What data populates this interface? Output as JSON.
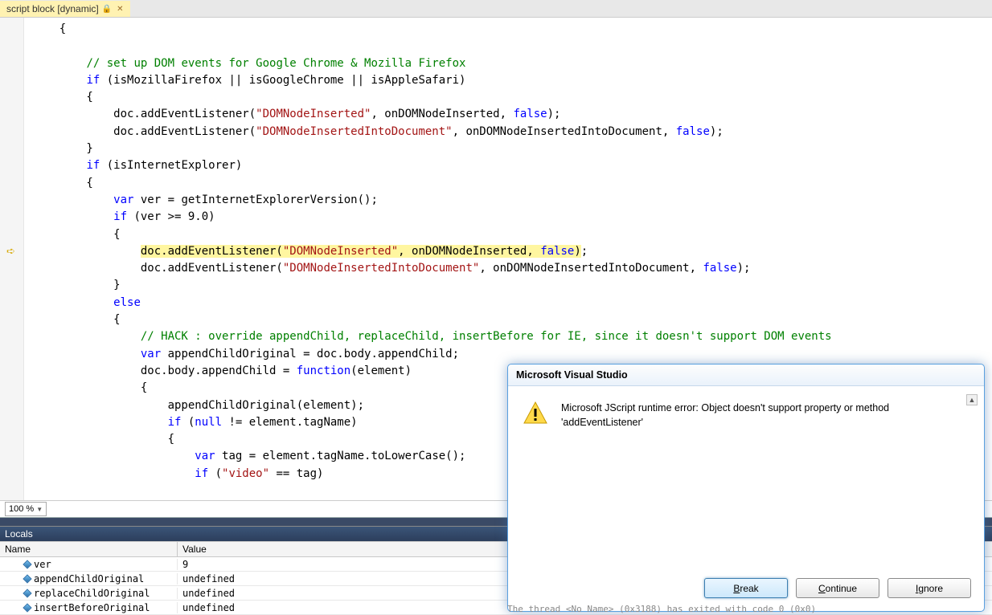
{
  "tab": {
    "label": "script block [dynamic]"
  },
  "zoom": {
    "value": "100 %"
  },
  "code": {
    "lines": [
      {
        "indent": 1,
        "tokens": [
          {
            "t": "{"
          }
        ]
      },
      {
        "indent": 1,
        "tokens": []
      },
      {
        "indent": 2,
        "tokens": [
          {
            "t": "// set up DOM events for Google Chrome & Mozilla Firefox",
            "cls": "cm"
          }
        ]
      },
      {
        "indent": 2,
        "tokens": [
          {
            "t": "if",
            "cls": "kw"
          },
          {
            "t": " (isMozillaFirefox || isGoogleChrome || isAppleSafari)"
          }
        ]
      },
      {
        "indent": 2,
        "tokens": [
          {
            "t": "{"
          }
        ]
      },
      {
        "indent": 3,
        "tokens": [
          {
            "t": "doc.addEventListener("
          },
          {
            "t": "\"DOMNodeInserted\"",
            "cls": "str"
          },
          {
            "t": ", onDOMNodeInserted, "
          },
          {
            "t": "false",
            "cls": "kw"
          },
          {
            "t": ");"
          }
        ]
      },
      {
        "indent": 3,
        "tokens": [
          {
            "t": "doc.addEventListener("
          },
          {
            "t": "\"DOMNodeInsertedIntoDocument\"",
            "cls": "str"
          },
          {
            "t": ", onDOMNodeInsertedIntoDocument, "
          },
          {
            "t": "false",
            "cls": "kw"
          },
          {
            "t": ");"
          }
        ]
      },
      {
        "indent": 2,
        "tokens": [
          {
            "t": "}"
          }
        ]
      },
      {
        "indent": 2,
        "tokens": [
          {
            "t": "if",
            "cls": "kw"
          },
          {
            "t": " (isInternetExplorer)"
          }
        ]
      },
      {
        "indent": 2,
        "tokens": [
          {
            "t": "{"
          }
        ]
      },
      {
        "indent": 3,
        "tokens": [
          {
            "t": "var",
            "cls": "kw"
          },
          {
            "t": " ver = getInternetExplorerVersion();"
          }
        ]
      },
      {
        "indent": 3,
        "tokens": [
          {
            "t": "if",
            "cls": "kw"
          },
          {
            "t": " (ver >= 9.0)"
          }
        ]
      },
      {
        "indent": 3,
        "tokens": [
          {
            "t": "{"
          }
        ]
      },
      {
        "indent": 4,
        "exec": true,
        "tokens": [
          {
            "t": "doc.addEventListener(",
            "hl": true
          },
          {
            "t": "\"DOMNodeInserted\"",
            "cls": "str",
            "hl": true
          },
          {
            "t": ", onDOMNodeInserted, ",
            "hl": true
          },
          {
            "t": "false",
            "cls": "kw",
            "hl": true
          },
          {
            "t": ")",
            "hl": true
          },
          {
            "t": ";"
          }
        ]
      },
      {
        "indent": 4,
        "tokens": [
          {
            "t": "doc.addEventListener("
          },
          {
            "t": "\"DOMNodeInsertedIntoDocument\"",
            "cls": "str"
          },
          {
            "t": ", onDOMNodeInsertedIntoDocument, "
          },
          {
            "t": "false",
            "cls": "kw"
          },
          {
            "t": ");"
          }
        ]
      },
      {
        "indent": 3,
        "tokens": [
          {
            "t": "}"
          }
        ]
      },
      {
        "indent": 3,
        "tokens": [
          {
            "t": "else",
            "cls": "kw"
          }
        ]
      },
      {
        "indent": 3,
        "tokens": [
          {
            "t": "{"
          }
        ]
      },
      {
        "indent": 4,
        "tokens": [
          {
            "t": "// HACK : override appendChild, replaceChild, insertBefore for IE, since it doesn't support DOM events",
            "cls": "cm"
          }
        ]
      },
      {
        "indent": 4,
        "tokens": [
          {
            "t": "var",
            "cls": "kw"
          },
          {
            "t": " appendChildOriginal = doc.body.appendChild;"
          }
        ]
      },
      {
        "indent": 4,
        "tokens": [
          {
            "t": "doc.body.appendChild = "
          },
          {
            "t": "function",
            "cls": "kw"
          },
          {
            "t": "(element)"
          }
        ]
      },
      {
        "indent": 4,
        "tokens": [
          {
            "t": "{"
          }
        ]
      },
      {
        "indent": 5,
        "tokens": [
          {
            "t": "appendChildOriginal(element);"
          }
        ]
      },
      {
        "indent": 5,
        "tokens": [
          {
            "t": "if",
            "cls": "kw"
          },
          {
            "t": " ("
          },
          {
            "t": "null",
            "cls": "kw"
          },
          {
            "t": " != element.tagName)"
          }
        ]
      },
      {
        "indent": 5,
        "tokens": [
          {
            "t": "{"
          }
        ]
      },
      {
        "indent": 6,
        "tokens": [
          {
            "t": "var",
            "cls": "kw"
          },
          {
            "t": " tag = element.tagName.toLowerCase();"
          }
        ]
      },
      {
        "indent": 6,
        "tokens": [
          {
            "t": "if",
            "cls": "kw"
          },
          {
            "t": " ("
          },
          {
            "t": "\"video\"",
            "cls": "str"
          },
          {
            "t": " == tag)"
          }
        ]
      }
    ]
  },
  "locals": {
    "title": "Locals",
    "headers": {
      "name": "Name",
      "value": "Value"
    },
    "rows": [
      {
        "name": "ver",
        "value": "9"
      },
      {
        "name": "appendChildOriginal",
        "value": "undefined"
      },
      {
        "name": "replaceChildOriginal",
        "value": "undefined"
      },
      {
        "name": "insertBeforeOriginal",
        "value": "undefined"
      }
    ]
  },
  "dialog": {
    "title": "Microsoft Visual Studio",
    "message": "Microsoft JScript runtime error: Object doesn't support property or method 'addEventListener'",
    "buttons": {
      "break": "Break",
      "continue": "Continue",
      "ignore": "Ignore"
    }
  },
  "status_fragment": "The thread  <No Name>  (0x3188) has exited with code 0 (0x0)"
}
